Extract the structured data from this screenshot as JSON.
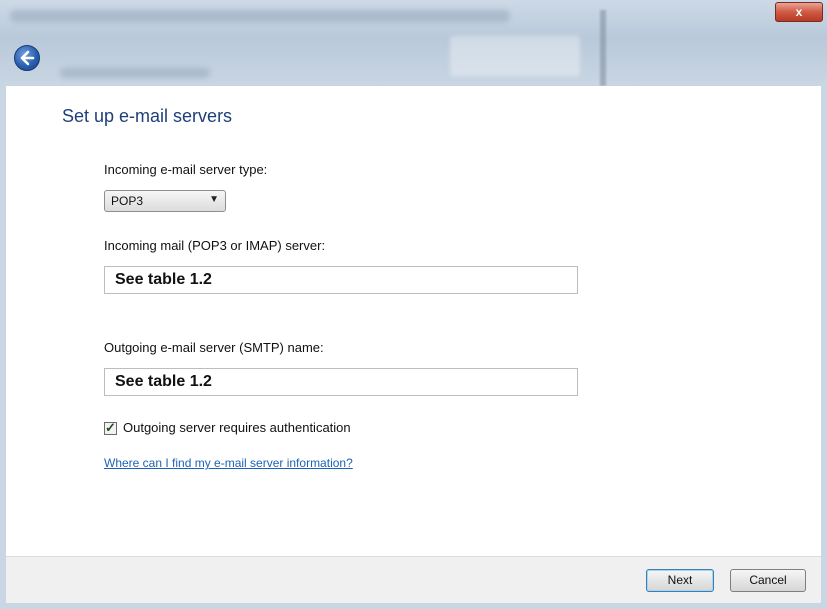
{
  "window": {
    "close_label": "x"
  },
  "page": {
    "heading": "Set up e-mail servers"
  },
  "form": {
    "incoming_type_label": "Incoming e-mail server type:",
    "incoming_type_value": "POP3",
    "incoming_server_label": "Incoming mail (POP3 or IMAP) server:",
    "incoming_server_value": "See table 1.2",
    "outgoing_server_label": "Outgoing e-mail server (SMTP) name:",
    "outgoing_server_value": "See table 1.2",
    "auth_checkbox_label": "Outgoing server requires authentication",
    "auth_checked": true,
    "help_link": "Where can I find my e-mail server information?"
  },
  "footer": {
    "next_label": "Next",
    "cancel_label": "Cancel"
  },
  "icons": {
    "back": "back-arrow-icon",
    "close": "close-icon",
    "dropdown": "chevron-down-icon",
    "check": "checkmark-icon"
  },
  "colors": {
    "heading": "#1e3f7a",
    "link": "#1d62b8",
    "close": "#c84a34"
  }
}
